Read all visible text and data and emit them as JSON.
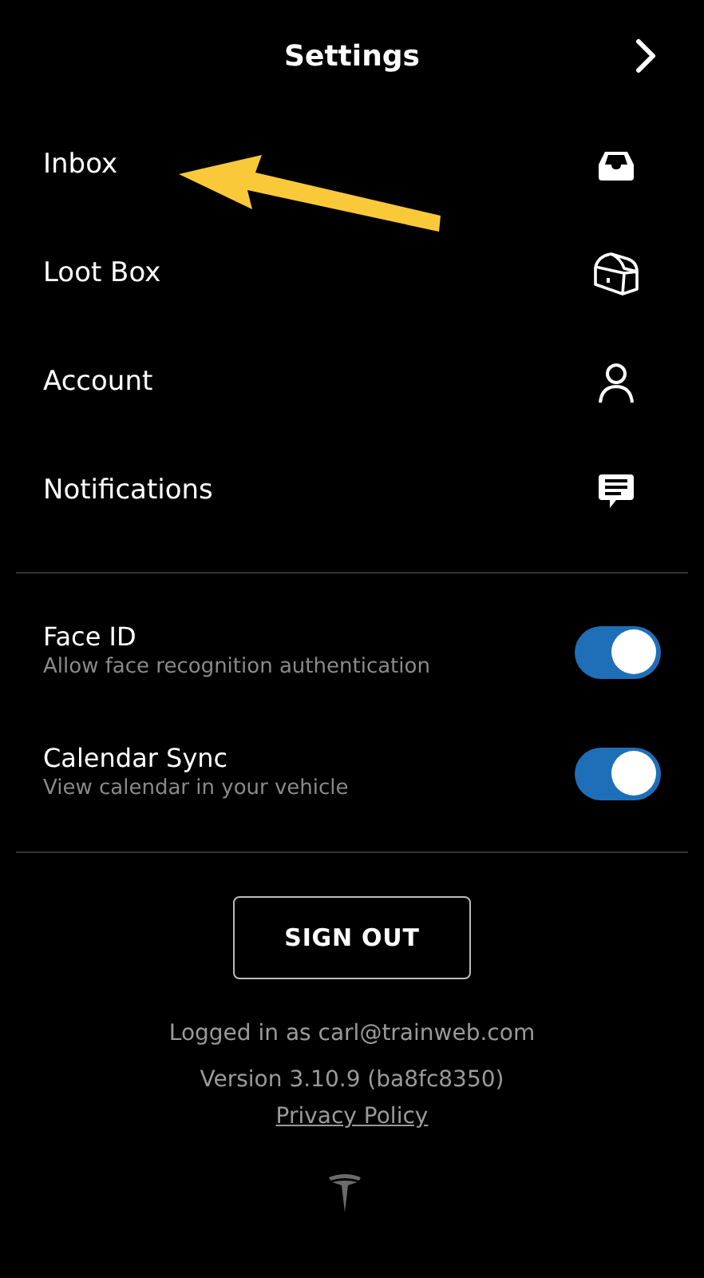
{
  "header": {
    "title": "Settings"
  },
  "menu_items": [
    {
      "label": "Inbox"
    },
    {
      "label": "Loot Box"
    },
    {
      "label": "Account"
    },
    {
      "label": "Notifications"
    }
  ],
  "toggles": [
    {
      "label": "Face ID",
      "description": "Allow face recognition authentication",
      "on": true
    },
    {
      "label": "Calendar Sync",
      "description": "View calendar in your vehicle",
      "on": true
    }
  ],
  "sign_out_button": "SIGN OUT",
  "footer": {
    "logged_in": "Logged in as carl@trainweb.com",
    "version": "Version 3.10.9 (ba8fc8350)",
    "privacy_link": "Privacy Policy"
  }
}
